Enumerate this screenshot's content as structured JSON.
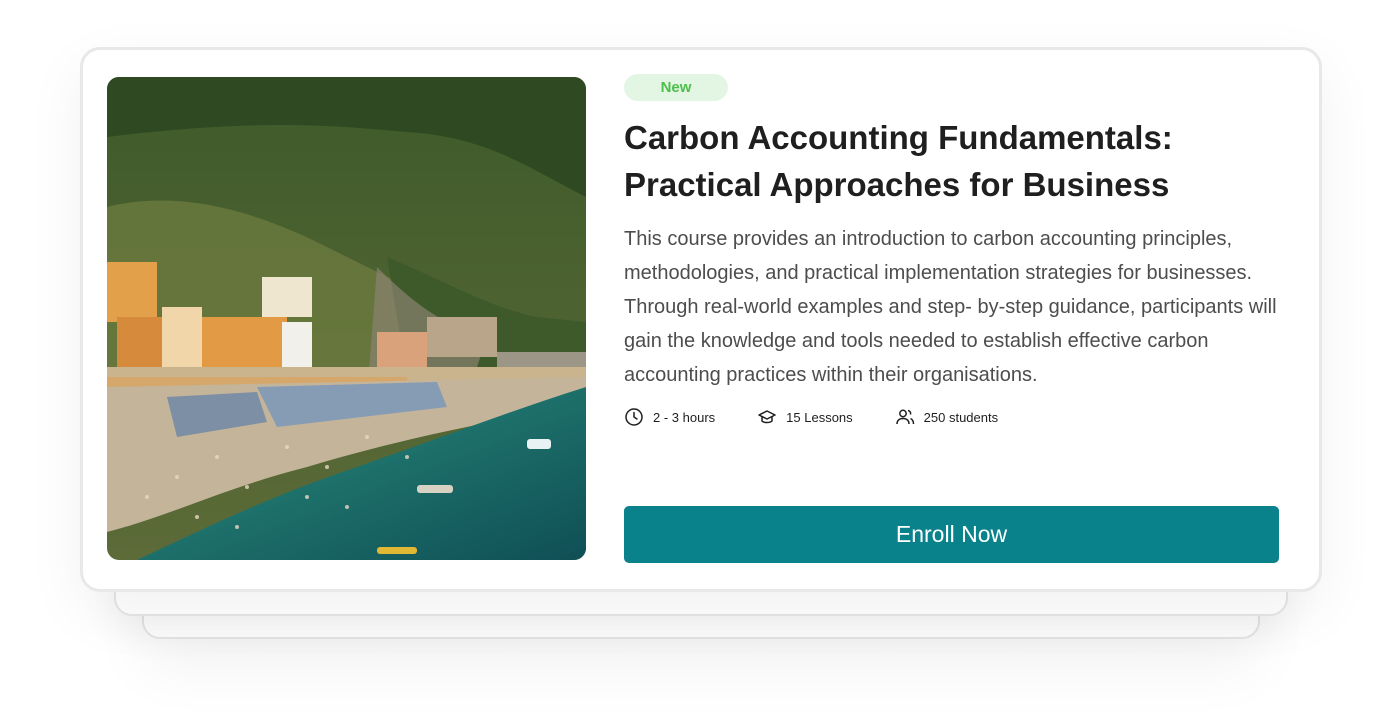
{
  "course": {
    "badge": "New",
    "title": "Carbon Accounting Fundamentals: Practical Approaches for Business",
    "description": "This course provides an introduction to carbon accounting principles, methodologies, and practical implementation strategies for businesses. Through real-world examples and step- by-step guidance, participants will gain the knowledge and tools needed to establish effective carbon accounting practices within their organisations.",
    "meta": {
      "duration": "2 - 3 hours",
      "lessons": "15 Lessons",
      "students": "250 students"
    },
    "enroll_label": "Enroll Now",
    "image_icon": "coastal-beach-photo"
  },
  "colors": {
    "accent": "#0a828c",
    "badge_bg": "#e3f6e3",
    "badge_text": "#4cbf4c",
    "title": "#1f1f1f",
    "body_text": "#4d4d4d"
  }
}
